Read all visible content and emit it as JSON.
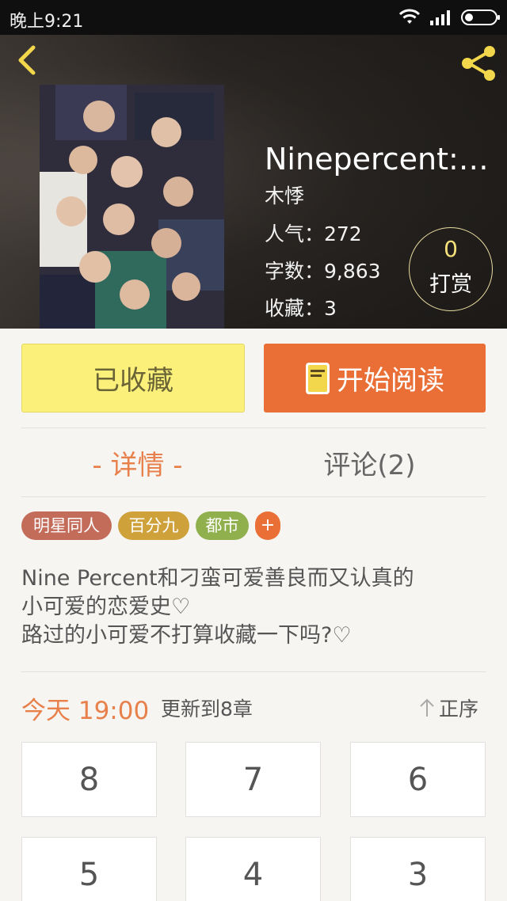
{
  "status_bar": {
    "time": "晚上9:21"
  },
  "book": {
    "title": "Ninepercent:不…",
    "author": "木悸",
    "popularity": "人气：272",
    "word_count": "字数：9,863",
    "favorites": "收藏：3",
    "reward_count": "0",
    "reward_label": "打赏"
  },
  "actions": {
    "favorite_label": "已收藏",
    "read_label": "开始阅读"
  },
  "tabs": {
    "detail": "- 详情 -",
    "comments": "评论(2)"
  },
  "tags": [
    "明星同人",
    "百分九",
    "都市"
  ],
  "tag_add": "+",
  "description": [
    "Nine Percent和刁蛮可爱善良而又认真的",
    "小可爱的恋爱史♡",
    "路过的小可爱不打算收藏一下吗?♡"
  ],
  "update": {
    "time": "今天 19:00",
    "info": "更新到8章",
    "sort_label": "正序"
  },
  "chapters": [
    "8",
    "7",
    "6",
    "5",
    "4",
    "3"
  ],
  "colors": {
    "accent": "#e96f37",
    "accent_text": "#e8804b",
    "favorite_bg": "#fbf07a",
    "tag_star": "#c46c5a",
    "tag_bfj": "#cfa13b",
    "tag_city": "#8fb04d"
  }
}
